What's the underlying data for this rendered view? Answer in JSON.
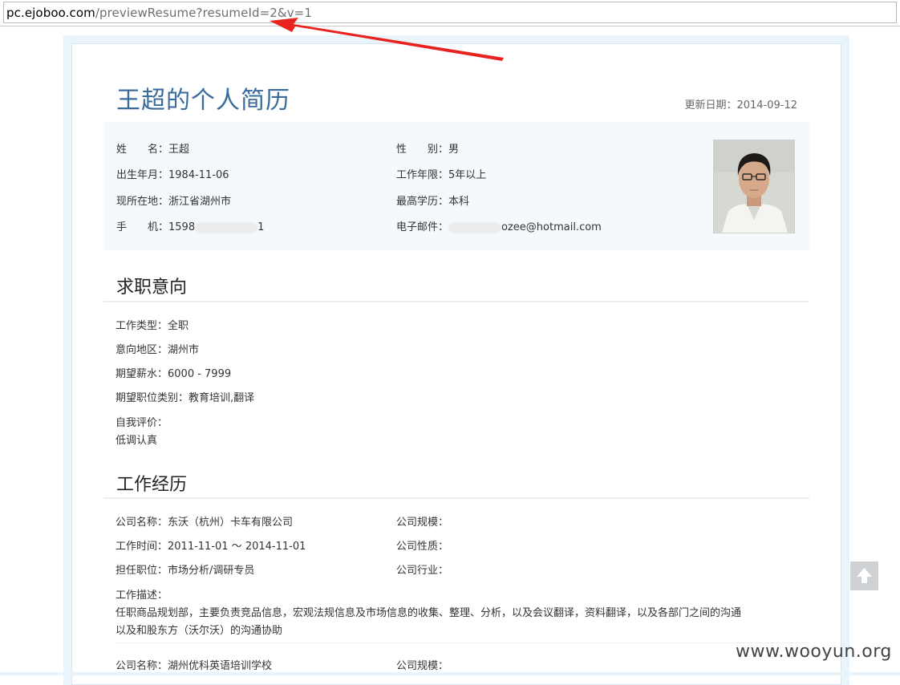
{
  "browser": {
    "url_domain": "pc.ejoboo.com",
    "url_path": "/previewResume?resumeId=2&v=1"
  },
  "resume": {
    "title": "王超的个人简历",
    "updated": "更新日期：2014-09-12",
    "info": {
      "name_label": "姓　　名：",
      "name": "王超",
      "gender_label": "性　　别：",
      "gender": "男",
      "birth_label": "出生年月：",
      "birth": "1984-11-06",
      "work_years_label": "工作年限：",
      "work_years": "5年以上",
      "location_label": "现所在地：",
      "location": "浙江省湖州市",
      "education_label": "最高学历：",
      "education": "本科",
      "phone_label": "手　　机：",
      "phone_prefix": "1598",
      "phone_suffix": "1",
      "email_label": "电子邮件：",
      "email_suffix": "ozee@hotmail.com"
    },
    "intention": {
      "heading": "求职意向",
      "job_type": "工作类型：全职",
      "region": "意向地区：湖州市",
      "salary": "期望薪水：6000 - 7999",
      "category": "期望职位类别：教育培训,翻译",
      "self_eval_label": "自我评价：",
      "self_eval": "低调认真"
    },
    "experience": {
      "heading": "工作经历",
      "jobs": [
        {
          "company": "公司名称：东沃（杭州）卡车有限公司",
          "scale": "公司规模：",
          "period": "工作时间：2011-11-01 ～ 2014-11-01",
          "nature": "公司性质：",
          "position": "担任职位：市场分析/调研专员",
          "industry": "公司行业：",
          "desc_label": "工作描述：",
          "desc_line1": "任职商品规划部，主要负责竞品信息，宏观法规信息及市场信息的收集、整理、分析，以及会议翻译，资料翻译，以及各部门之间的沟通",
          "desc_line2": "以及和股东方（沃尔沃）的沟通协助"
        },
        {
          "company": "公司名称：湖州优科英语培训学校",
          "scale": "公司规模："
        }
      ]
    }
  },
  "watermark": "www.wooyun.org",
  "icons": {
    "scroll_top": "arrow-up-icon",
    "annotation": "red-arrow-icon"
  }
}
